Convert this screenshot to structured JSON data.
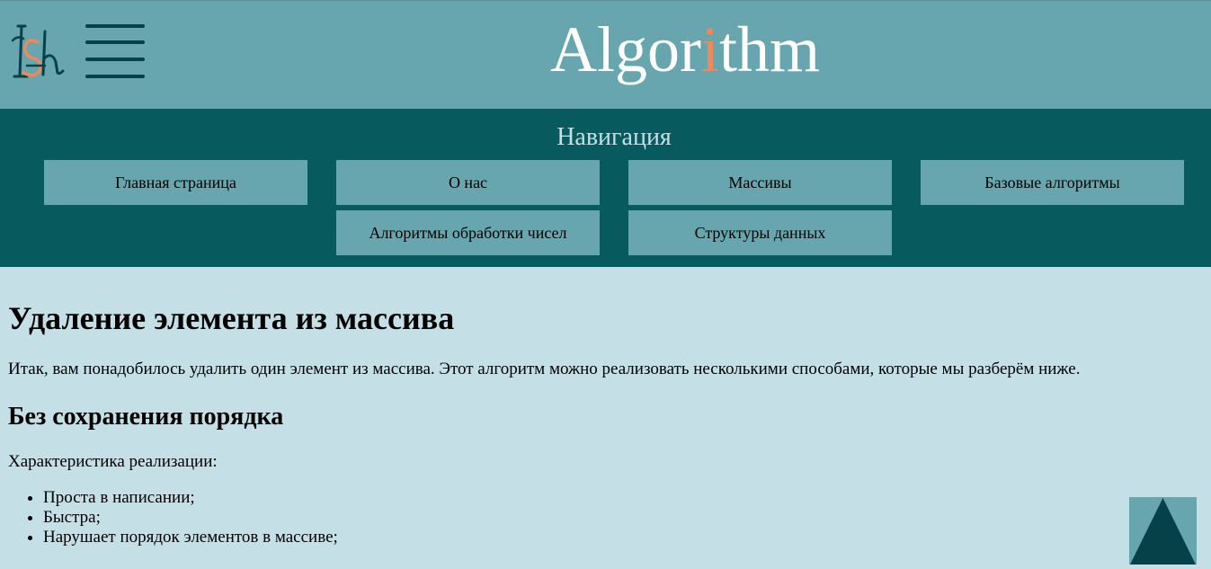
{
  "header": {
    "logo_icon": "ish-logo-icon",
    "menu_icon": "hamburger-menu-icon",
    "title_before": "Algor",
    "title_accent": "i",
    "title_after": "thm",
    "colors": {
      "header_bg": "#67a6ae",
      "nav_bg": "#075a5d",
      "page_bg": "#c4dfe5",
      "accent": "#ec8a5c",
      "dark": "#06414a"
    }
  },
  "nav": {
    "heading": "Навигация",
    "items": [
      {
        "label": "Главная страница"
      },
      {
        "label": "О нас"
      },
      {
        "label": "Массивы"
      },
      {
        "label": "Базовые алгоритмы"
      },
      {
        "label": "Алгоритмы обработки чисел"
      },
      {
        "label": "Структуры данных"
      }
    ]
  },
  "main": {
    "title": "Удаление элемента из массива",
    "intro": "Итак, вам понадобилось удалить один элемент из массива. Этот алгоритм можно реализовать несколькими способами, которые мы разберём ниже.",
    "section_title": "Без сохранения порядка",
    "characteristic_label": "Характеристика реализации:",
    "features": [
      "Проста в написании;",
      "Быстра;",
      "Нарушает порядок элементов в массиве;"
    ]
  },
  "scroll_top": {
    "icon": "arrow-up-triangle-icon"
  }
}
